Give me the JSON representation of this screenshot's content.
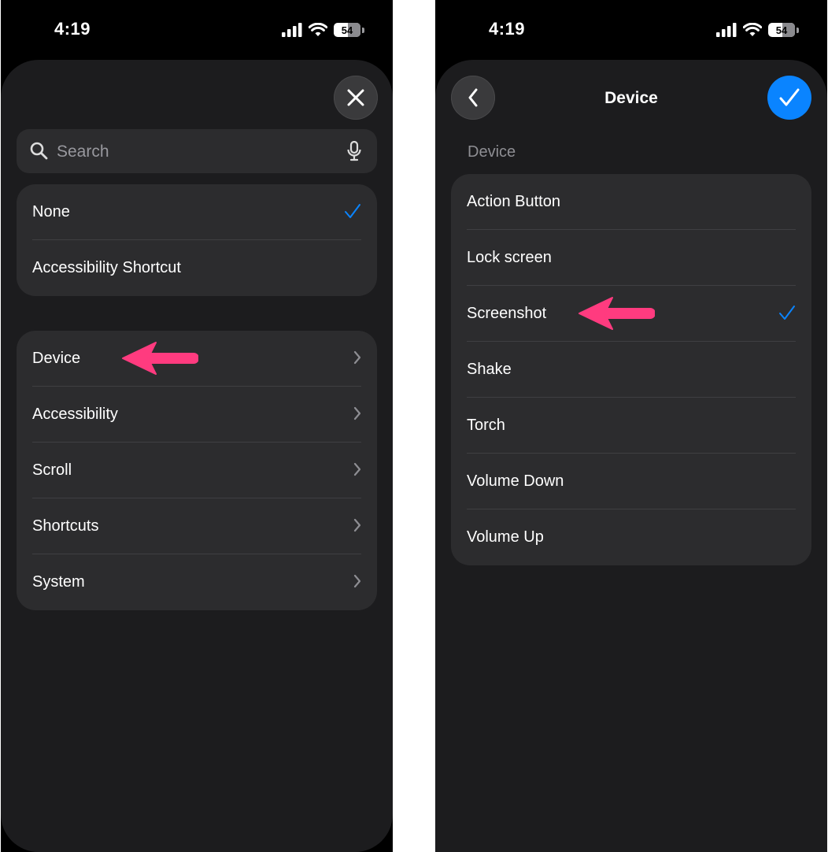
{
  "colors": {
    "accent": "#0a84ff",
    "annotation_arrow": "#ff3b7f",
    "sheet_bg": "#1c1c1e",
    "cell_bg": "#2c2c2e"
  },
  "left": {
    "status": {
      "time": "4:19",
      "battery": "54"
    },
    "close_icon": "close-icon",
    "search": {
      "placeholder": "Search",
      "icons": [
        "search-icon",
        "mic-icon"
      ]
    },
    "top_group": [
      {
        "label": "None",
        "selected": true
      },
      {
        "label": "Accessibility Shortcut",
        "selected": false
      }
    ],
    "category_group": [
      {
        "label": "Device"
      },
      {
        "label": "Accessibility"
      },
      {
        "label": "Scroll"
      },
      {
        "label": "Shortcuts"
      },
      {
        "label": "System"
      }
    ]
  },
  "right": {
    "status": {
      "time": "4:19",
      "battery": "54"
    },
    "nav": {
      "title": "Device",
      "back_icon": "chevron-left-icon",
      "done_icon": "checkmark-icon"
    },
    "section_header": "Device",
    "items": [
      {
        "label": "Action Button",
        "selected": false
      },
      {
        "label": "Lock screen",
        "selected": false
      },
      {
        "label": "Screenshot",
        "selected": true
      },
      {
        "label": "Shake",
        "selected": false
      },
      {
        "label": "Torch",
        "selected": false
      },
      {
        "label": "Volume Down",
        "selected": false
      },
      {
        "label": "Volume Up",
        "selected": false
      }
    ]
  }
}
